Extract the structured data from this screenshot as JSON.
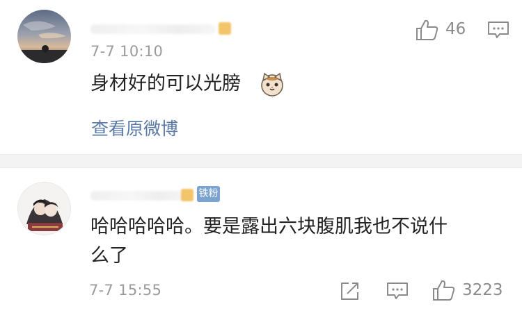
{
  "comment1": {
    "time": "7-7 10:10",
    "text": "身材好的可以光膀",
    "emoji": "cat-emoji",
    "like_count": "46",
    "view_original_label": "查看原微博"
  },
  "comment2": {
    "fan_badge": "铁粉",
    "text_line1": "哈哈哈哈哈。要是露出六块腹肌我也不说什",
    "text_line2": "么了",
    "time": "7-7 15:55",
    "like_count": "3223"
  },
  "colors": {
    "link": "#5b79a6",
    "fan_badge": "#7aa3cf",
    "separator": "#f3f3f3",
    "muted_text": "#9a9a9a"
  }
}
